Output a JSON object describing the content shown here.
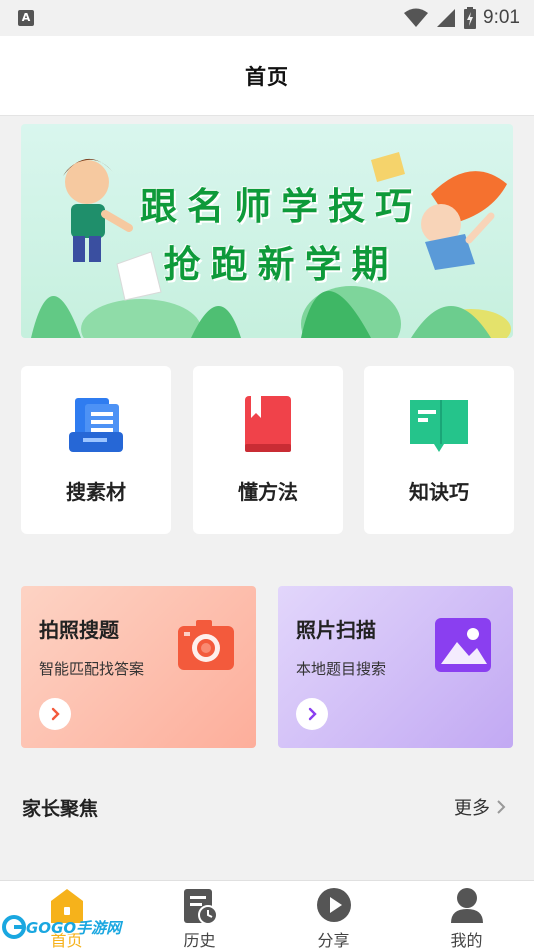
{
  "status_bar": {
    "time": "9:01",
    "app_badge": "A"
  },
  "header": {
    "title": "首页"
  },
  "banner": {
    "line1": "跟名师学技巧",
    "line2": "抢跑新学期"
  },
  "categories": [
    {
      "label": "搜素材",
      "icon": "document-stack-icon",
      "color": "#2f7cf0"
    },
    {
      "label": "懂方法",
      "icon": "red-book-icon",
      "color": "#f0424a"
    },
    {
      "label": "知诀巧",
      "icon": "green-book-icon",
      "color": "#25c48b"
    }
  ],
  "features": [
    {
      "title": "拍照搜题",
      "subtitle": "智能匹配找答案",
      "icon": "camera-icon",
      "color": "#f35a3c"
    },
    {
      "title": "照片扫描",
      "subtitle": "本地题目搜索",
      "icon": "image-icon",
      "color": "#8a3ff0"
    }
  ],
  "section": {
    "title": "家长聚焦",
    "more_label": "更多"
  },
  "tabs": [
    {
      "label": "首页",
      "icon": "home-icon",
      "active": true
    },
    {
      "label": "历史",
      "icon": "history-icon",
      "active": false
    },
    {
      "label": "分享",
      "icon": "share-play-icon",
      "active": false
    },
    {
      "label": "我的",
      "icon": "user-icon",
      "active": false
    }
  ],
  "watermark": {
    "text": "GOGO手游网"
  }
}
